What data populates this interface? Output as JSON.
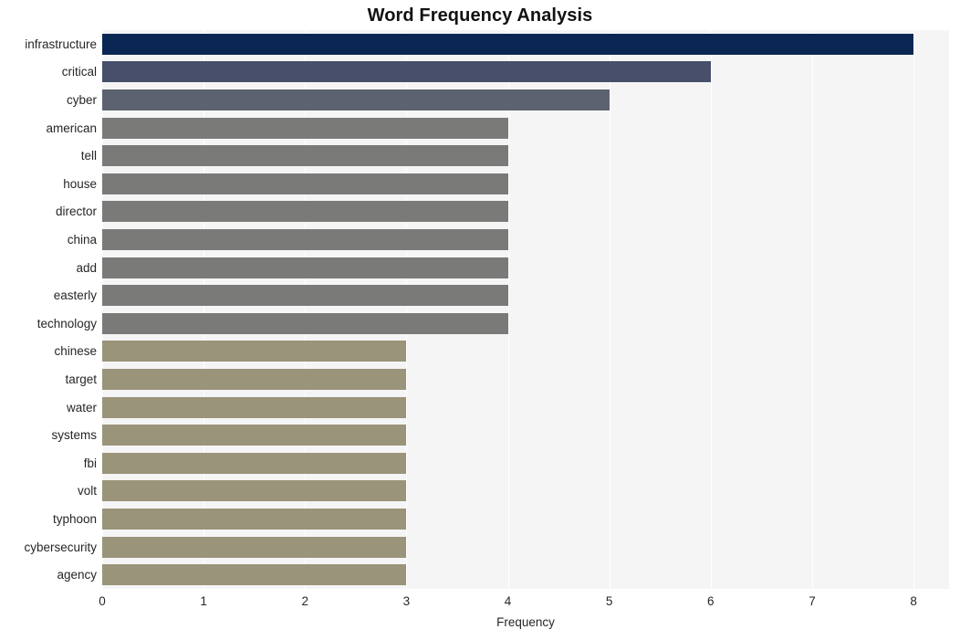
{
  "chart_data": {
    "type": "bar",
    "orientation": "horizontal",
    "title": "Word Frequency Analysis",
    "xlabel": "Frequency",
    "ylabel": "",
    "categories": [
      "infrastructure",
      "critical",
      "cyber",
      "american",
      "tell",
      "house",
      "director",
      "china",
      "add",
      "easterly",
      "technology",
      "chinese",
      "target",
      "water",
      "systems",
      "fbi",
      "volt",
      "typhoon",
      "cybersecurity",
      "agency"
    ],
    "values": [
      8,
      6,
      5,
      4,
      4,
      4,
      4,
      4,
      4,
      4,
      4,
      3,
      3,
      3,
      3,
      3,
      3,
      3,
      3,
      3
    ],
    "bar_colors": [
      "#0a2753",
      "#474f6b",
      "#5d6270",
      "#7a7a78",
      "#7a7a78",
      "#7a7a78",
      "#7a7a78",
      "#7a7a78",
      "#7a7a78",
      "#7a7a78",
      "#7a7a78",
      "#9a947b",
      "#9a947b",
      "#9a947b",
      "#9a947b",
      "#9a947b",
      "#9a947b",
      "#9a947b",
      "#9a947b",
      "#9a947b"
    ],
    "xlim": [
      0,
      8.35
    ],
    "xticks": [
      0,
      1,
      2,
      3,
      4,
      5,
      6,
      7,
      8
    ],
    "xtick_labels": [
      "0",
      "1",
      "2",
      "3",
      "4",
      "5",
      "6",
      "7",
      "8"
    ],
    "grid": true,
    "grid_axis": "x",
    "grid_color": "#ffffff",
    "plot_background": "#f5f5f5",
    "figure_background": "#ffffff",
    "legend": null
  }
}
